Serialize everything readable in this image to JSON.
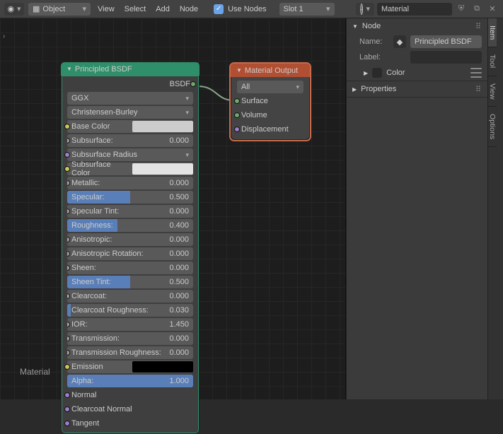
{
  "header": {
    "mode_label": "Object",
    "menus": [
      "View",
      "Select",
      "Add",
      "Node"
    ],
    "use_nodes_label": "Use Nodes",
    "slot_label": "Slot 1",
    "material_name": "Material"
  },
  "breadcrumb_glyph": "›",
  "canvas_label": "Material",
  "principled": {
    "title": "Principled BSDF",
    "output_label": "BSDF",
    "distribution": "GGX",
    "sss_method": "Christensen-Burley",
    "sss_radius_label": "Subsurface Radius",
    "colors": {
      "base": {
        "label": "Base Color",
        "hex": "#cccccc"
      },
      "subsurface": {
        "label": "Subsurface Color",
        "hex": "#e3e3e3"
      },
      "emission": {
        "label": "Emission",
        "hex": "#000000"
      }
    },
    "sliders": [
      {
        "label": "Subsurface:",
        "value": "0.000",
        "fill": 0.0
      },
      {
        "label": "Metallic:",
        "value": "0.000",
        "fill": 0.0
      },
      {
        "label": "Specular:",
        "value": "0.500",
        "fill": 0.5
      },
      {
        "label": "Specular Tint:",
        "value": "0.000",
        "fill": 0.0
      },
      {
        "label": "Roughness:",
        "value": "0.400",
        "fill": 0.4
      },
      {
        "label": "Anisotropic:",
        "value": "0.000",
        "fill": 0.0
      },
      {
        "label": "Anisotropic Rotation:",
        "value": "0.000",
        "fill": 0.0
      },
      {
        "label": "Sheen:",
        "value": "0.000",
        "fill": 0.0
      },
      {
        "label": "Sheen Tint:",
        "value": "0.500",
        "fill": 0.5
      },
      {
        "label": "Clearcoat:",
        "value": "0.000",
        "fill": 0.0
      },
      {
        "label": "Clearcoat Roughness:",
        "value": "0.030",
        "fill": 0.03
      },
      {
        "label": "IOR:",
        "value": "1.450",
        "fill": 0.0
      },
      {
        "label": "Transmission:",
        "value": "0.000",
        "fill": 0.0
      },
      {
        "label": "Transmission Roughness:",
        "value": "0.000",
        "fill": 0.0
      },
      {
        "label": "Alpha:",
        "value": "1.000",
        "fill": 1.0
      }
    ],
    "vectors": [
      "Normal",
      "Clearcoat Normal",
      "Tangent"
    ]
  },
  "material_output": {
    "title": "Material Output",
    "target": "All",
    "inputs": [
      "Surface",
      "Volume",
      "Displacement"
    ]
  },
  "sidepanel": {
    "node_section": "Node",
    "name_label": "Name:",
    "name_value": "Principled BSDF",
    "label_label": "Label:",
    "label_value": "",
    "color_label": "Color",
    "properties_section": "Properties"
  },
  "tabs": [
    "Item",
    "Tool",
    "View",
    "Options"
  ]
}
